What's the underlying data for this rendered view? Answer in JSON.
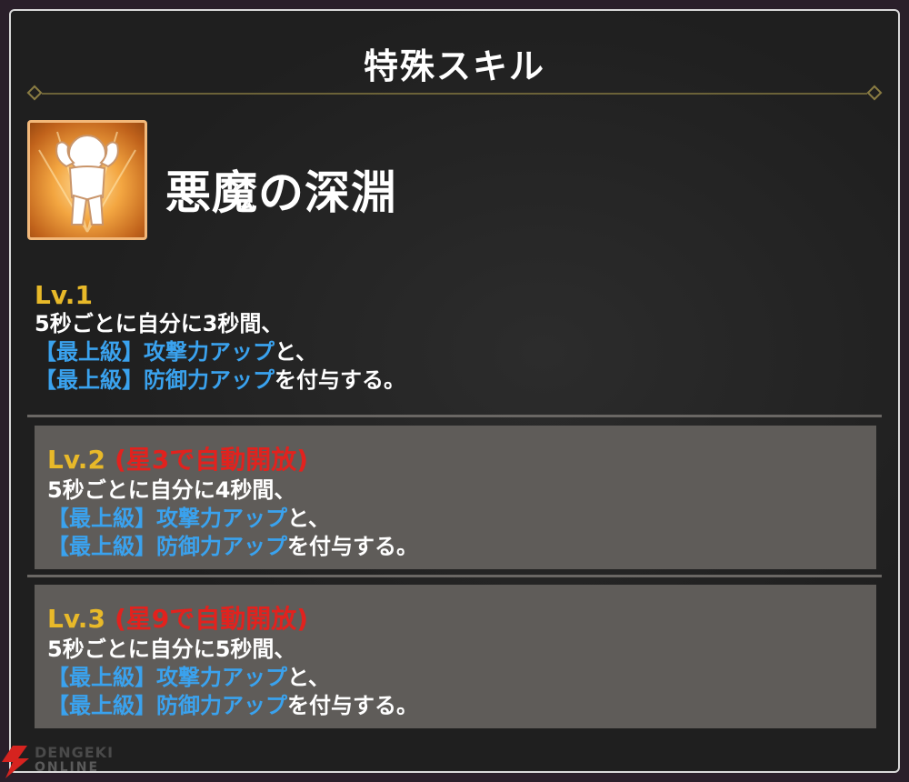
{
  "header": {
    "title": "特殊スキル"
  },
  "skill": {
    "name": "悪魔の深淵",
    "icon": "flexing-figure-icon"
  },
  "levels": [
    {
      "level": "Lv.1",
      "unlock": "",
      "line1": "5秒ごとに自分に3秒間、",
      "buff1": "【最上級】攻撃力アップ",
      "conj": "と、",
      "buff2": "【最上級】防御力アップ",
      "tail": "を付与する。"
    },
    {
      "level": "Lv.2",
      "unlock": "(星3で自動開放)",
      "line1": "5秒ごとに自分に4秒間、",
      "buff1": "【最上級】攻撃力アップ",
      "conj": "と、",
      "buff2": "【最上級】防御力アップ",
      "tail": "を付与する。"
    },
    {
      "level": "Lv.3",
      "unlock": "(星9で自動開放)",
      "line1": "5秒ごとに自分に5秒間、",
      "buff1": "【最上級】攻撃力アップ",
      "conj": "と、",
      "buff2": "【最上級】防御力アップ",
      "tail": "を付与する。"
    }
  ],
  "watermark": {
    "line1": "DENGEKI",
    "line2": "ONLINE"
  },
  "colors": {
    "level_gold": "#e8b929",
    "unlock_red": "#e2221e",
    "buff_blue": "#3aa2ee",
    "panel_bg": "#1f1f1f",
    "locked_box": "#5f5c59"
  }
}
